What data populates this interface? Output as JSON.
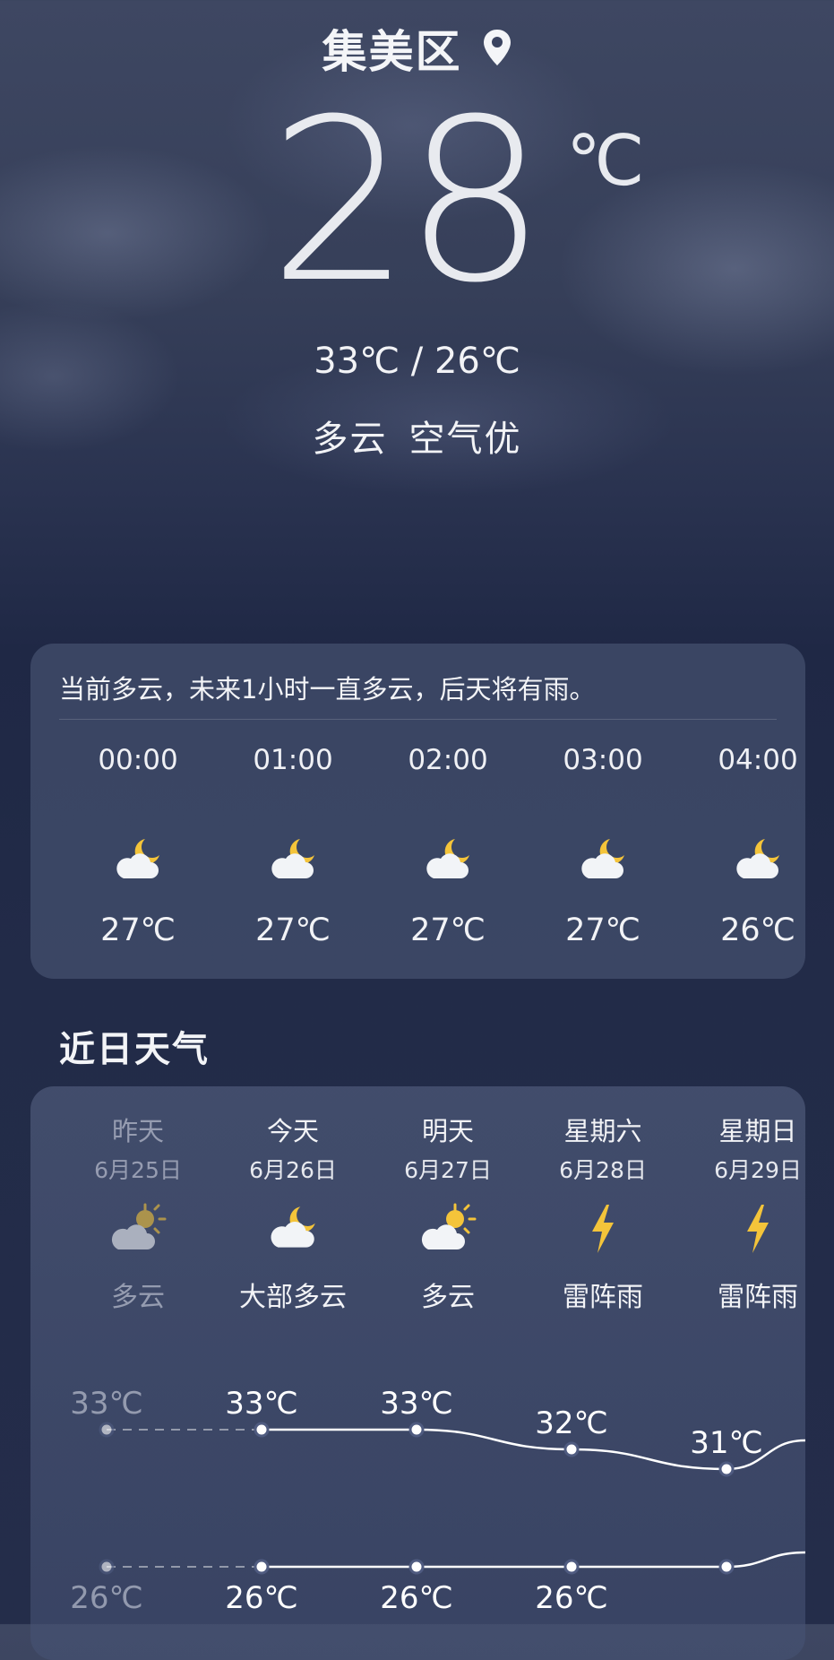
{
  "header": {
    "location": "集美区",
    "location_icon": "location-pin-icon",
    "current_temp": "28",
    "temp_unit": "℃",
    "range": "33℃ / 26℃",
    "condition": "多云",
    "air_quality": "空气优"
  },
  "hourly": {
    "summary": "当前多云，未来1小时一直多云，后天将有雨。",
    "items": [
      {
        "time": "00:00",
        "icon": "night-partly-cloudy-icon",
        "temp": "27℃"
      },
      {
        "time": "01:00",
        "icon": "night-partly-cloudy-icon",
        "temp": "27℃"
      },
      {
        "time": "02:00",
        "icon": "night-partly-cloudy-icon",
        "temp": "27℃"
      },
      {
        "time": "03:00",
        "icon": "night-partly-cloudy-icon",
        "temp": "27℃"
      },
      {
        "time": "04:00",
        "icon": "night-partly-cloudy-icon",
        "temp": "26℃"
      }
    ]
  },
  "daily": {
    "title": "近日天气",
    "days": [
      {
        "name": "昨天",
        "date": "6月25日",
        "icon": "day-partly-cloudy-icon",
        "condition": "多云",
        "high": "33℃",
        "low": "26℃",
        "high_value": 33,
        "low_value": 26
      },
      {
        "name": "今天",
        "date": "6月26日",
        "icon": "night-partly-cloudy-icon",
        "condition": "大部多云",
        "high": "33℃",
        "low": "26℃",
        "high_value": 33,
        "low_value": 26
      },
      {
        "name": "明天",
        "date": "6月27日",
        "icon": "day-partly-cloudy-icon",
        "condition": "多云",
        "high": "33℃",
        "low": "26℃",
        "high_value": 33,
        "low_value": 26
      },
      {
        "name": "星期六",
        "date": "6月28日",
        "icon": "thunderstorm-icon",
        "condition": "雷阵雨",
        "high": "32℃",
        "low": "26℃",
        "high_value": 32,
        "low_value": 26
      },
      {
        "name": "星期日",
        "date": "6月29日",
        "icon": "thunderstorm-icon",
        "condition": "雷阵雨",
        "high": "31℃",
        "low": "",
        "high_value": 31,
        "low_value": 26
      }
    ]
  }
}
